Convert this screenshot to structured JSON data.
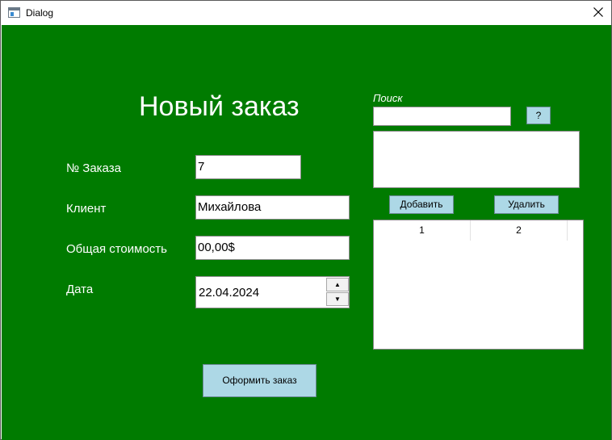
{
  "window": {
    "title": "Dialog"
  },
  "form": {
    "heading": "Новый заказ",
    "order_no_label": "№ Заказа",
    "order_no_value": "7",
    "client_label": "Клиент",
    "client_value": "Михайлова",
    "total_label": "Общая стоимость",
    "total_value": "00,00$",
    "date_label": "Дата",
    "date_value": "22.04.2024",
    "submit_label": "Оформить заказ"
  },
  "search": {
    "label": "Поиск",
    "value": "",
    "help_button": "?",
    "add_button": "Добавить",
    "remove_button": "Удалить"
  },
  "table": {
    "columns": [
      "1",
      "2"
    ],
    "rows": []
  },
  "colors": {
    "background": "#007b00",
    "button": "#add8e6",
    "text_on_background": "#ffffff"
  },
  "icons": {
    "app": "window-app-icon",
    "close": "close-icon",
    "spin_up": "arrow-up-icon",
    "spin_down": "arrow-down-icon"
  }
}
